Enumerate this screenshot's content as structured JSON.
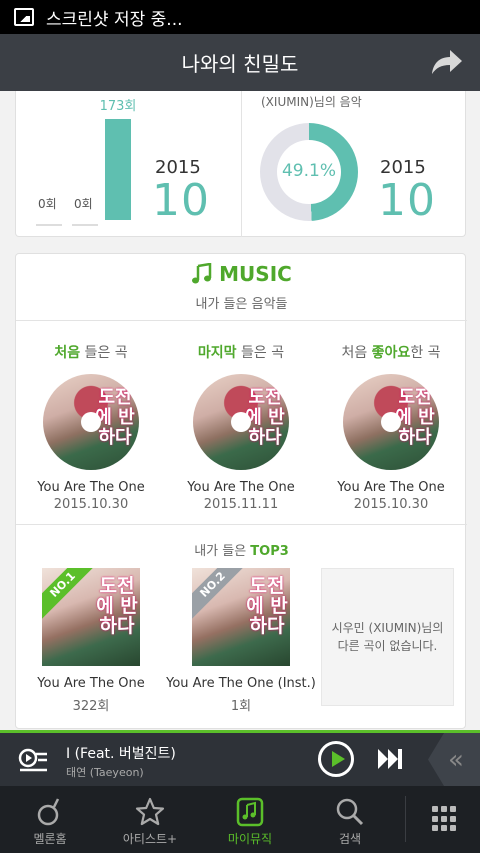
{
  "status_bar": {
    "text": "스크린샷 저장 중..."
  },
  "header": {
    "title": "나와의 친밀도"
  },
  "intimacy": {
    "left": {
      "top_count": "173회",
      "zero1": "0회",
      "zero2": "0회",
      "year": "2015",
      "month": "10",
      "bar_fill_fraction": 1.0
    },
    "right": {
      "caption": "(XIUMIN)님의 음악",
      "percent": "49.1%",
      "percent_value": 49.1,
      "year": "2015",
      "month": "10"
    }
  },
  "music": {
    "title": "MUSIC",
    "subtitle": "내가 들은 음악들",
    "columns": [
      {
        "cap_highlight": "처음",
        "cap_rest": " 들은 곡",
        "cap_prefix": "",
        "song": "You Are The One",
        "date": "2015.10.30"
      },
      {
        "cap_highlight": "마지막",
        "cap_rest": " 들은 곡",
        "cap_prefix": "",
        "song": "You Are The One",
        "date": "2015.11.11"
      },
      {
        "cap_highlight": "좋아요",
        "cap_rest": "한 곡",
        "cap_prefix": "처음 ",
        "song": "You Are The One",
        "date": "2015.10.30"
      }
    ],
    "album_text": "도전에 반하다",
    "top3": {
      "title_prefix": "내가 들은 ",
      "title_highlight": "TOP3",
      "items": [
        {
          "rank": "NO.1",
          "song": "You Are The One",
          "plays": "322회"
        },
        {
          "rank": "NO.2",
          "song": "You Are The One (Inst.)",
          "plays": "1회"
        }
      ],
      "empty_message": "시우민 (XIUMIN)님의 다른 곡이 없습니다."
    }
  },
  "player": {
    "title": "I (Feat. 버벌진트)",
    "artist": "태연 (Taeyeon)"
  },
  "nav": {
    "tabs": [
      {
        "label": "멜론홈",
        "icon": "melon-home-icon"
      },
      {
        "label": "아티스트+",
        "icon": "star-icon"
      },
      {
        "label": "마이뮤직",
        "icon": "my-music-icon"
      },
      {
        "label": "검색",
        "icon": "search-icon"
      }
    ],
    "active_index": 2
  },
  "colors": {
    "teal": "#5fbfb0",
    "green": "#5bbf2a",
    "header_bg": "#3b3f45",
    "nav_bg": "#1d2024"
  }
}
